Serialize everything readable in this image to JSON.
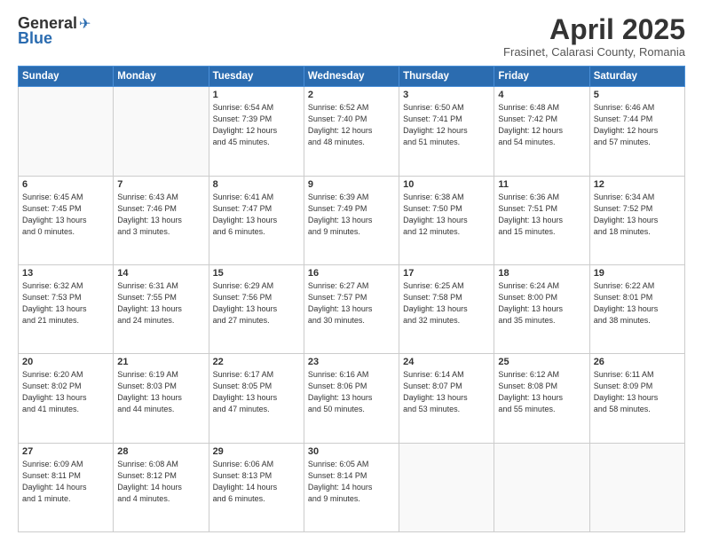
{
  "header": {
    "logo_general": "General",
    "logo_blue": "Blue",
    "month_title": "April 2025",
    "subtitle": "Frasinet, Calarasi County, Romania"
  },
  "days_of_week": [
    "Sunday",
    "Monday",
    "Tuesday",
    "Wednesday",
    "Thursday",
    "Friday",
    "Saturday"
  ],
  "weeks": [
    [
      {
        "day": "",
        "info": ""
      },
      {
        "day": "",
        "info": ""
      },
      {
        "day": "1",
        "info": "Sunrise: 6:54 AM\nSunset: 7:39 PM\nDaylight: 12 hours\nand 45 minutes."
      },
      {
        "day": "2",
        "info": "Sunrise: 6:52 AM\nSunset: 7:40 PM\nDaylight: 12 hours\nand 48 minutes."
      },
      {
        "day": "3",
        "info": "Sunrise: 6:50 AM\nSunset: 7:41 PM\nDaylight: 12 hours\nand 51 minutes."
      },
      {
        "day": "4",
        "info": "Sunrise: 6:48 AM\nSunset: 7:42 PM\nDaylight: 12 hours\nand 54 minutes."
      },
      {
        "day": "5",
        "info": "Sunrise: 6:46 AM\nSunset: 7:44 PM\nDaylight: 12 hours\nand 57 minutes."
      }
    ],
    [
      {
        "day": "6",
        "info": "Sunrise: 6:45 AM\nSunset: 7:45 PM\nDaylight: 13 hours\nand 0 minutes."
      },
      {
        "day": "7",
        "info": "Sunrise: 6:43 AM\nSunset: 7:46 PM\nDaylight: 13 hours\nand 3 minutes."
      },
      {
        "day": "8",
        "info": "Sunrise: 6:41 AM\nSunset: 7:47 PM\nDaylight: 13 hours\nand 6 minutes."
      },
      {
        "day": "9",
        "info": "Sunrise: 6:39 AM\nSunset: 7:49 PM\nDaylight: 13 hours\nand 9 minutes."
      },
      {
        "day": "10",
        "info": "Sunrise: 6:38 AM\nSunset: 7:50 PM\nDaylight: 13 hours\nand 12 minutes."
      },
      {
        "day": "11",
        "info": "Sunrise: 6:36 AM\nSunset: 7:51 PM\nDaylight: 13 hours\nand 15 minutes."
      },
      {
        "day": "12",
        "info": "Sunrise: 6:34 AM\nSunset: 7:52 PM\nDaylight: 13 hours\nand 18 minutes."
      }
    ],
    [
      {
        "day": "13",
        "info": "Sunrise: 6:32 AM\nSunset: 7:53 PM\nDaylight: 13 hours\nand 21 minutes."
      },
      {
        "day": "14",
        "info": "Sunrise: 6:31 AM\nSunset: 7:55 PM\nDaylight: 13 hours\nand 24 minutes."
      },
      {
        "day": "15",
        "info": "Sunrise: 6:29 AM\nSunset: 7:56 PM\nDaylight: 13 hours\nand 27 minutes."
      },
      {
        "day": "16",
        "info": "Sunrise: 6:27 AM\nSunset: 7:57 PM\nDaylight: 13 hours\nand 30 minutes."
      },
      {
        "day": "17",
        "info": "Sunrise: 6:25 AM\nSunset: 7:58 PM\nDaylight: 13 hours\nand 32 minutes."
      },
      {
        "day": "18",
        "info": "Sunrise: 6:24 AM\nSunset: 8:00 PM\nDaylight: 13 hours\nand 35 minutes."
      },
      {
        "day": "19",
        "info": "Sunrise: 6:22 AM\nSunset: 8:01 PM\nDaylight: 13 hours\nand 38 minutes."
      }
    ],
    [
      {
        "day": "20",
        "info": "Sunrise: 6:20 AM\nSunset: 8:02 PM\nDaylight: 13 hours\nand 41 minutes."
      },
      {
        "day": "21",
        "info": "Sunrise: 6:19 AM\nSunset: 8:03 PM\nDaylight: 13 hours\nand 44 minutes."
      },
      {
        "day": "22",
        "info": "Sunrise: 6:17 AM\nSunset: 8:05 PM\nDaylight: 13 hours\nand 47 minutes."
      },
      {
        "day": "23",
        "info": "Sunrise: 6:16 AM\nSunset: 8:06 PM\nDaylight: 13 hours\nand 50 minutes."
      },
      {
        "day": "24",
        "info": "Sunrise: 6:14 AM\nSunset: 8:07 PM\nDaylight: 13 hours\nand 53 minutes."
      },
      {
        "day": "25",
        "info": "Sunrise: 6:12 AM\nSunset: 8:08 PM\nDaylight: 13 hours\nand 55 minutes."
      },
      {
        "day": "26",
        "info": "Sunrise: 6:11 AM\nSunset: 8:09 PM\nDaylight: 13 hours\nand 58 minutes."
      }
    ],
    [
      {
        "day": "27",
        "info": "Sunrise: 6:09 AM\nSunset: 8:11 PM\nDaylight: 14 hours\nand 1 minute."
      },
      {
        "day": "28",
        "info": "Sunrise: 6:08 AM\nSunset: 8:12 PM\nDaylight: 14 hours\nand 4 minutes."
      },
      {
        "day": "29",
        "info": "Sunrise: 6:06 AM\nSunset: 8:13 PM\nDaylight: 14 hours\nand 6 minutes."
      },
      {
        "day": "30",
        "info": "Sunrise: 6:05 AM\nSunset: 8:14 PM\nDaylight: 14 hours\nand 9 minutes."
      },
      {
        "day": "",
        "info": ""
      },
      {
        "day": "",
        "info": ""
      },
      {
        "day": "",
        "info": ""
      }
    ]
  ]
}
